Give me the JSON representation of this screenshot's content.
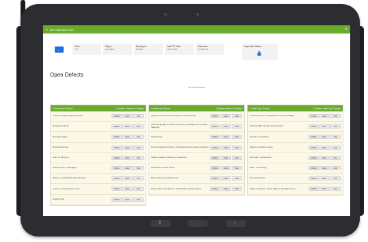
{
  "header": {
    "title": "Van inspection form",
    "close_icon": "close-icon"
  },
  "info": {
    "back_label": "←",
    "cards": [
      {
        "label": "Fleet",
        "value": "T50"
      },
      {
        "label": "Depot",
        "value": "Dunstable"
      },
      {
        "label": "Employee",
        "value": "53404G"
      },
      {
        "label": "Last PTI Date",
        "value": "21-01-1900"
      },
      {
        "label": "Odometer",
        "value": "37,594.414"
      }
    ],
    "status_label": "Inspection Status",
    "status_icon": "droplet-icon",
    "status_color": "#3d7fd0"
  },
  "defects": {
    "title": "Open Defects",
    "empty_text": "No record found"
  },
  "buttons": {
    "pass": "PASS",
    "fail": "FAIL",
    "na": "N/A"
  },
  "panels": [
    {
      "title": "External Checks",
      "confirm": "Confirm External Checks",
      "items": [
        "Loose or projecting body panels",
        "Damaged mirrors",
        "Damaged glass",
        "Damaged lenses",
        "Worn or flat tyres",
        "Exterior dirty or damaged",
        "Obvious coolant/fuel leaks (Diesel)",
        "Loose or missing wheel nuts",
        "Engine belts"
      ]
    },
    {
      "title": "Internal Checks",
      "confirm": "Confirm Internal Checks",
      "items": [
        "Safety mounted devices absent or inoperational",
        "Internal signage or tools missing (e.g. Emergency exit signs / hammer)",
        "Interior dirty",
        "Fire extinguishers absent, discharged and not date compliant",
        "Safety triangles missing or unsecured",
        "Automatic window issues",
        "Drive seat or seat belt issues",
        "Driver cabin tools (broom, wheelchair hooks) missing"
      ]
    },
    {
      "title": "Start Up Checks",
      "confirm": "Confirm Start Up Checks",
      "items": [
        "Controls (horns not operational / tool by calling)",
        "Steering light / buzzer alerts at start",
        "Gauges not working",
        "Wipers or washer issues",
        "Demister / confectional",
        "Alarm not working",
        "Horn inoperative",
        "Lights, indicators, wheel lights or day light issues"
      ]
    }
  ],
  "colors": {
    "accent": "#6aab2b",
    "primary": "#1e6fd9",
    "panel_bg": "#fcf8e8"
  }
}
